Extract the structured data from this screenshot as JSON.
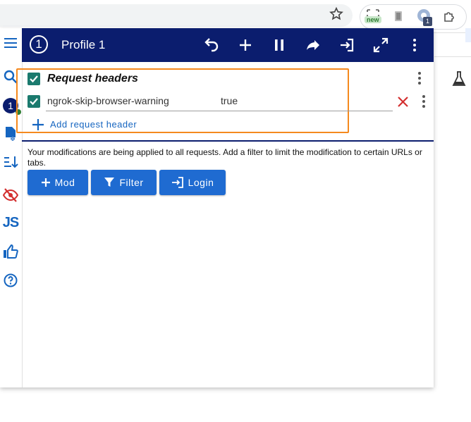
{
  "browser": {
    "extension_badge_new": "new",
    "extension_count": "1"
  },
  "header": {
    "profile_number": "1",
    "profile_title": "Profile 1",
    "sidebar_profile_number": "1"
  },
  "sidebar": {
    "js_label": "JS"
  },
  "request_headers": {
    "title": "Request headers",
    "enabled": true,
    "rows": [
      {
        "name": "ngrok-skip-browser-warning",
        "value": "true",
        "enabled": true
      }
    ],
    "add_label": "Add request header"
  },
  "info_text": "Your modifications are being applied to all requests. Add a filter to limit the modification to certain URLs or tabs.",
  "actions": {
    "mod_label": "Mod",
    "filter_label": "Filter",
    "login_label": "Login"
  },
  "colors": {
    "header_bg": "#0b1d6e",
    "accent_blue": "#1f6bd1",
    "checkbox_teal": "#1b7a6e",
    "highlight_orange": "#f5891e",
    "delete_red": "#d32f2f"
  }
}
